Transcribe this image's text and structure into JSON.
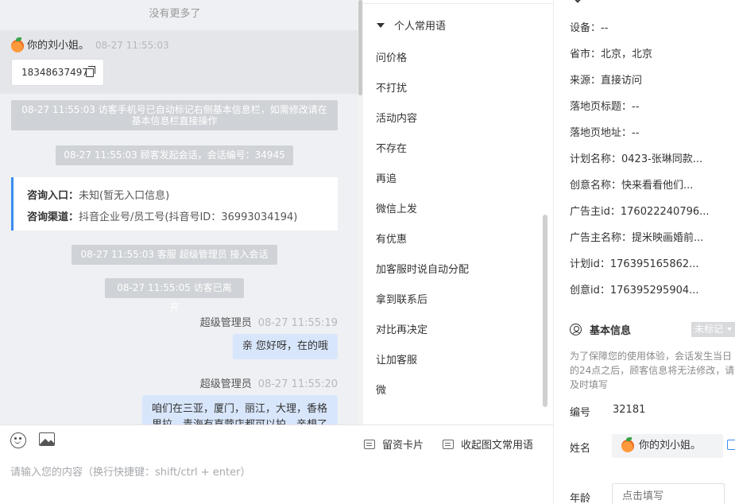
{
  "chat": {
    "no_more": "没有更多了",
    "visitor_name": "你的刘小姐。",
    "visitor_time": "08-27 11:55:03",
    "phone": "18348637497",
    "sys_msg_1": "08-27 11:55:03 访客手机号已自动标记右侧基本信息栏，如需修改请在基本信息栏直接操作",
    "sys_msg_2": "08-27 11:55:03 顾客发起会话，会话编号：34945",
    "entry_label": "咨询入口：",
    "entry_value": "未知(暂无入口信息)",
    "channel_label": "咨询渠道：",
    "channel_value": "抖音企业号/员工号(抖音号ID：36993034194)",
    "sys_msg_3": "08-27 11:55:03 客服 超级管理员 接入会话",
    "sys_msg_4": "08-27 11:55:05 访客已离开",
    "agent_name_1": "超级管理员",
    "agent_time_1": "08-27 11:55:19",
    "agent_msg_1": "亲 您好呀，在的哦",
    "agent_name_2": "超级管理员",
    "agent_time_2": "08-27 11:55:20",
    "agent_msg_2": "咱们在三亚，厦门，丽江，大理，香格里拉，青海有直营店都可以拍，亲想了"
  },
  "input": {
    "card_button": "留资卡片",
    "collapse_button": "收起图文常用语",
    "placeholder": "请输入您的内容（换行快捷键：shift/ctrl + enter）"
  },
  "phrases": {
    "group_title": "个人常用语",
    "items": [
      "问价格",
      "不打扰",
      "活动内容",
      "不存在",
      "再追",
      "微信上发",
      "有优惠",
      "加客服时说自动分配",
      "拿到联系后",
      "对比再决定",
      "让加客服",
      "微"
    ]
  },
  "profile": {
    "fields": [
      {
        "label": "设备：",
        "value": "--"
      },
      {
        "label": "省市：",
        "value": "北京，北京"
      },
      {
        "label": "来源：",
        "value": "直接访问"
      },
      {
        "label": "落地页标题：",
        "value": "--"
      },
      {
        "label": "落地页地址：",
        "value": "--"
      },
      {
        "label": "计划名称：",
        "value": "0423-张琳同款..."
      },
      {
        "label": "创意名称：",
        "value": "快来看看他们..."
      },
      {
        "label": "广告主id：",
        "value": "176022240796..."
      },
      {
        "label": "广告主名称：",
        "value": "提米映画婚前..."
      },
      {
        "label": "计划id：",
        "value": "176395165862..."
      },
      {
        "label": "创意id：",
        "value": "176395295904..."
      }
    ],
    "section_title": "基本信息",
    "tag": "未标记",
    "note": "为了保障您的使用体验，会话发生当日的24点之后，顾客信息将无法修改，请及时填写",
    "id_label": "编号",
    "id_value": "32181",
    "name_label": "姓名",
    "name_value": "你的刘小姐。",
    "age_label": "年龄",
    "age_placeholder": "点击填写"
  }
}
